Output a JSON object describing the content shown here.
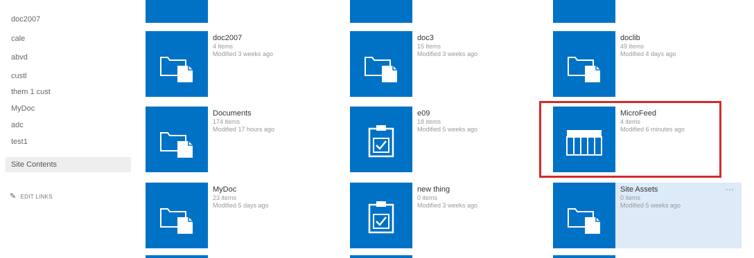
{
  "nav": {
    "items": [
      {
        "label": "doc2007"
      },
      {
        "label": "cale"
      },
      {
        "label": "abvd"
      },
      {
        "label": "custl"
      },
      {
        "label": "them 1 cust"
      },
      {
        "label": "MyDoc"
      },
      {
        "label": "adc"
      },
      {
        "label": "test1"
      },
      {
        "label": "Site Contents"
      }
    ],
    "edit_links": "EDIT LINKS"
  },
  "tiles": [
    {
      "title": "doc2007",
      "count": "4 items",
      "modified": "Modified 3 weeks ago",
      "icon": "folder-icon"
    },
    {
      "title": "doc3",
      "count": "15 items",
      "modified": "Modified 3 weeks ago",
      "icon": "folder-icon"
    },
    {
      "title": "doclib",
      "count": "49 items",
      "modified": "Modified 4 days ago",
      "icon": "folder-icon"
    },
    {
      "title": "Documents",
      "count": "174 items",
      "modified": "Modified 17 hours ago",
      "icon": "folder-icon"
    },
    {
      "title": "e09",
      "count": "18 items",
      "modified": "Modified 5 weeks ago",
      "icon": "clipboard-check-icon"
    },
    {
      "title": "MicroFeed",
      "count": "4 items",
      "modified": "Modified 6 minutes ago",
      "icon": "list-grid-icon"
    },
    {
      "title": "MyDoc",
      "count": "23 items",
      "modified": "Modified 5 days ago",
      "icon": "folder-icon"
    },
    {
      "title": "new thing",
      "count": "0 items",
      "modified": "Modified 3 weeks ago",
      "icon": "clipboard-check-icon"
    },
    {
      "title": "Site Assets",
      "count": "0 items",
      "modified": "Modified 5 weeks ago",
      "icon": "folder-icon",
      "menu": "..."
    }
  ],
  "colors": {
    "tile": "#0072c6",
    "highlight": "#d42a2a",
    "hover": "#ddeaf7"
  }
}
